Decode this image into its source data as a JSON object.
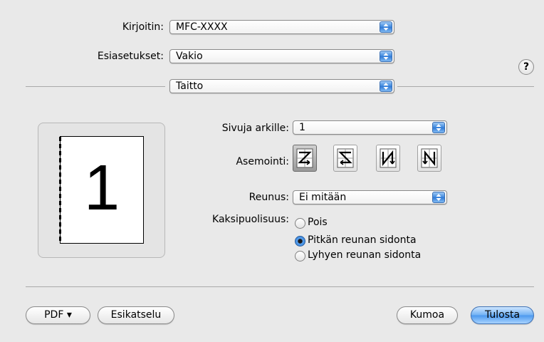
{
  "printer": {
    "label": "Kirjoitin:",
    "value": "MFC-XXXX"
  },
  "presets": {
    "label": "Esiasetukset:",
    "value": "Vakio"
  },
  "help": {
    "symbol": "?"
  },
  "panel": {
    "value": "Taitto"
  },
  "preview": {
    "page_number": "1"
  },
  "pages_per_sheet": {
    "label": "Sivuja arkille:",
    "value": "1"
  },
  "layout_direction": {
    "label": "Asemointi:",
    "options": [
      "z-left-right-icon",
      "reverse-z-icon",
      "n-top-bottom-icon",
      "reverse-n-icon"
    ],
    "selected_index": 0
  },
  "border": {
    "label": "Reunus:",
    "value": "Ei mitään"
  },
  "duplex": {
    "label": "Kaksipuolisuus:",
    "options": [
      "Pois",
      "Pitkän reunan sidonta",
      "Lyhyen reunan sidonta"
    ],
    "selected_index": 1
  },
  "footer": {
    "pdf_label": "PDF ▾",
    "preview_label": "Esikatselu",
    "cancel_label": "Kumoa",
    "print_label": "Tulosta"
  },
  "colors": {
    "accent": "#3b86dd",
    "background": "#e9e9e9"
  }
}
